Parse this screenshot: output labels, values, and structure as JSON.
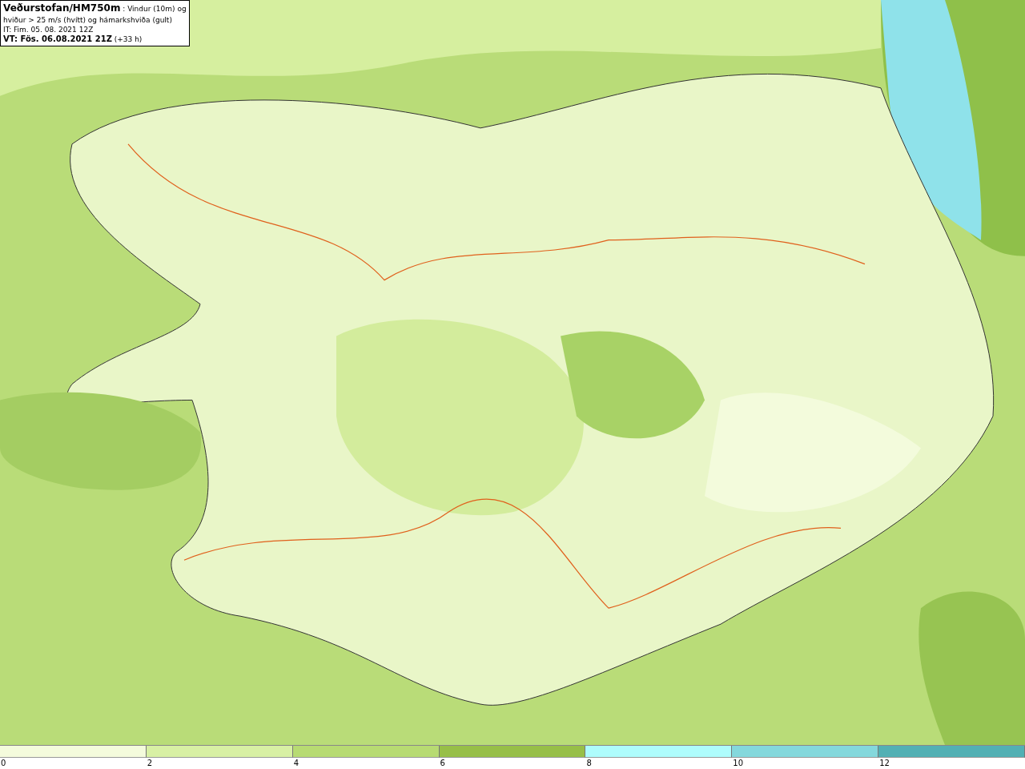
{
  "header": {
    "lines": [
      "**Veðurstofan/HM750m** : Vindur (10m) og",
      "hviður > 25 m/s (hvítt) og hámarkshviða (gult)",
      "IT: Fim. 05. 08. 2021 12Z",
      "**VT: Fös. 06.08.2021 21Z** (+33 h)"
    ]
  },
  "legend": [
    {
      "label": "0",
      "color": "#f4fbdc"
    },
    {
      "label": "2",
      "color": "#d8f0a4"
    },
    {
      "label": "4",
      "color": "#b7db72"
    },
    {
      "label": "6",
      "color": "#97bf48"
    },
    {
      "label": "8",
      "color": "#aefcfc"
    },
    {
      "label": "10",
      "color": "#84d8dc"
    },
    {
      "label": "12",
      "color": "#52b0b4"
    }
  ]
}
